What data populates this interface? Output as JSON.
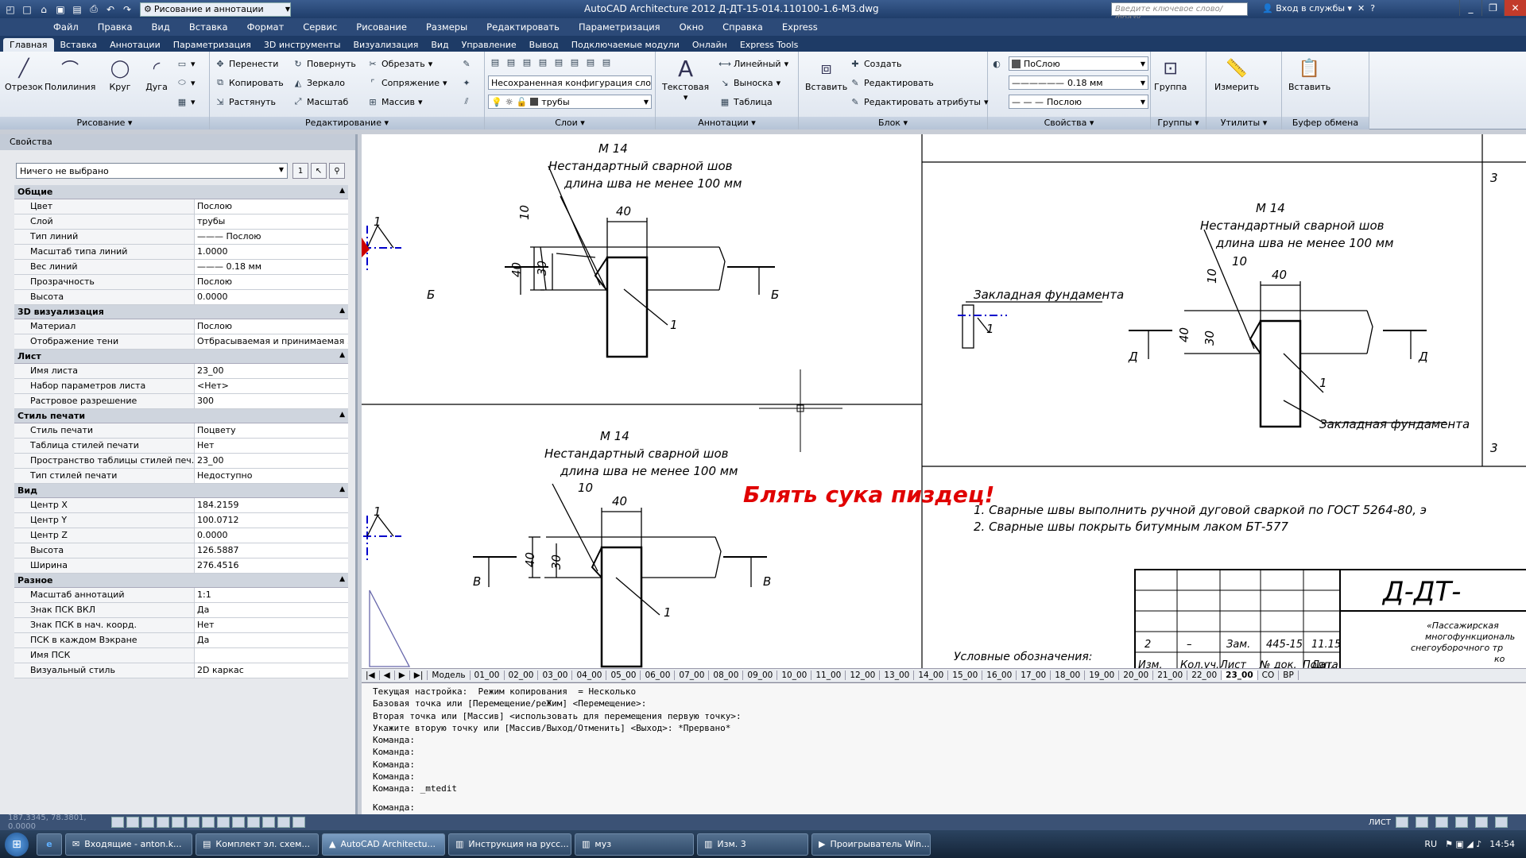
{
  "title_bar": {
    "workspace": "Рисование и аннотации",
    "app_title": "AutoCAD Architecture 2012   Д-ДТ-15-014.110100-1.6-МЗ.dwg",
    "search_placeholder": "Введите ключевое слово/фразу",
    "signin": "Вход в службы"
  },
  "menu": [
    "Файл",
    "Правка",
    "Вид",
    "Вставка",
    "Формат",
    "Сервис",
    "Рисование",
    "Размеры",
    "Редактировать",
    "Параметризация",
    "Окно",
    "Справка",
    "Express"
  ],
  "tabs": [
    "Главная",
    "Вставка",
    "Аннотации",
    "Параметризация",
    "3D инструменты",
    "Визуализация",
    "Вид",
    "Управление",
    "Вывод",
    "Подключаемые модули",
    "Онлайн",
    "Express Tools"
  ],
  "ribbon": {
    "draw": {
      "title": "Рисование",
      "line": "Отрезок",
      "polyline": "Полилиния",
      "circle": "Круг",
      "arc": "Дуга"
    },
    "modify": {
      "title": "Редактирование",
      "move": "Перенести",
      "rotate": "Повернуть",
      "trim": "Обрезать",
      "copy": "Копировать",
      "mirror": "Зеркало",
      "fillet": "Сопряжение",
      "stretch": "Растянуть",
      "scale": "Масштаб",
      "array": "Массив"
    },
    "layers": {
      "title": "Слои",
      "state": "Несохраненная конфигурация сло",
      "layer": "трубы"
    },
    "annotation": {
      "title": "Аннотации",
      "text": "Текстовая",
      "linear": "Линейный",
      "leader": "Выноска",
      "table": "Таблица"
    },
    "block": {
      "title": "Блок",
      "insert": "Вставить",
      "create": "Создать",
      "edit": "Редактировать",
      "edit_attr": "Редактировать атрибуты"
    },
    "properties": {
      "title": "Свойства",
      "color": "ПоСлою",
      "lineweight": "0.18 мм",
      "linetype": "Послою"
    },
    "groups": {
      "title": "Группы",
      "group": "Группа"
    },
    "utilities": {
      "title": "Утилиты",
      "measure": "Измерить"
    },
    "clipboard": {
      "title": "Буфер обмена",
      "paste": "Вставить"
    }
  },
  "props": {
    "header": "Свойства",
    "selection": "Ничего не выбрано",
    "sections": [
      {
        "name": "Общие",
        "rows": [
          [
            "Цвет",
            "Послою"
          ],
          [
            "Слой",
            "трубы"
          ],
          [
            "Тип линий",
            "——— Послою"
          ],
          [
            "Масштаб типа линий",
            "1.0000"
          ],
          [
            "Вес линий",
            "——— 0.18 мм"
          ],
          [
            "Прозрачность",
            "Послою"
          ],
          [
            "Высота",
            "0.0000"
          ]
        ]
      },
      {
        "name": "3D визуализация",
        "rows": [
          [
            "Материал",
            "Послою"
          ],
          [
            "Отображение тени",
            "Отбрасываемая и принимаемая ..."
          ]
        ]
      },
      {
        "name": "Лист",
        "rows": [
          [
            "Имя листа",
            "23_00"
          ],
          [
            "Набор параметров листа",
            "<Нет>"
          ],
          [
            "Растровое разрешение",
            "300"
          ]
        ]
      },
      {
        "name": "Стиль печати",
        "rows": [
          [
            "Стиль печати",
            "Поцвету"
          ],
          [
            "Таблица стилей печати",
            "Нет"
          ],
          [
            "Пространство таблицы стилей печ...",
            "23_00"
          ],
          [
            "Тип стилей печати",
            "Недоступно"
          ]
        ]
      },
      {
        "name": "Вид",
        "rows": [
          [
            "Центр X",
            "184.2159"
          ],
          [
            "Центр Y",
            "100.0712"
          ],
          [
            "Центр Z",
            "0.0000"
          ],
          [
            "Высота",
            "126.5887"
          ],
          [
            "Ширина",
            "276.4516"
          ]
        ]
      },
      {
        "name": "Разное",
        "rows": [
          [
            "Масштаб аннотаций",
            "1:1"
          ],
          [
            "Знак ПСК ВКЛ",
            "Да"
          ],
          [
            "Знак ПСК в нач. коорд.",
            "Нет"
          ],
          [
            "ПСК в каждом Вэкране",
            "Да"
          ],
          [
            "Имя ПСК",
            ""
          ],
          [
            "Визуальный стиль",
            "2D каркас"
          ]
        ]
      }
    ]
  },
  "drawing": {
    "m14": "M 14",
    "weld1": "Нестандартный сварной шов",
    "weld2": "длина шва не менее  100  мм",
    "d40": "40",
    "d10": "10",
    "d30": "30",
    "one": "1",
    "b": "Б",
    "v": "В",
    "d": "Д",
    "embed": "Закладная фундамента",
    "red": "Блять сука пиздец!",
    "note1": "1. Сварные швы выполнить ручной дуговой сваркой по ГОСТ 5264-80, э",
    "note2": "2. Сварные швы покрыть битумным лаком БТ-577",
    "legend": "Условные обозначения:",
    "stamp_code": "Д-ДТ-",
    "stamp_org1": "«Пассажирская",
    "stamp_org2": "многофункциональ",
    "stamp_org3": "снегоуборочного тр",
    "stamp_org4": "ко",
    "stamp_row": [
      "2",
      "–",
      "Зам.",
      "445-15",
      "",
      "11.15"
    ],
    "stamp_hdr": [
      "Изм.",
      "Кол.уч.",
      "Лист",
      "№ док.",
      "Подп.",
      "Дата"
    ],
    "side3": "3"
  },
  "layout_tabs": [
    "Модель",
    "01_00",
    "02_00",
    "03_00",
    "04_00",
    "05_00",
    "06_00",
    "07_00",
    "08_00",
    "09_00",
    "10_00",
    "11_00",
    "12_00",
    "13_00",
    "14_00",
    "15_00",
    "16_00",
    "17_00",
    "18_00",
    "19_00",
    "20_00",
    "21_00",
    "22_00",
    "23_00",
    "СО",
    "ВР"
  ],
  "command": {
    "lines": "Текущая настройка:  Режим копирования  = Несколько\nБазовая точка или [Перемещение/реЖим] <Перемещение>:\nВторая точка или [Массив] <использовать для перемещения первую точку>:\nУкажите вторую точку или [Массив/Выход/Отменить] <Выход>: *Прервано*\nКоманда:\nКоманда:\nКоманда:\nКоманда:\nКоманда: _mtedit",
    "prompt": "Команда:"
  },
  "status": {
    "coords": "187.3345, 78.3801, 0.0000",
    "paper": "ЛИСТ"
  },
  "taskbar": {
    "items": [
      "Входящие - anton.k...",
      "Комплект эл. схем...",
      "AutoCAD Architectu...",
      "Инструкция на русс...",
      "муз",
      "Изм. 3",
      "Проигрыватель Win..."
    ],
    "lang": "RU",
    "time": "14:54"
  }
}
